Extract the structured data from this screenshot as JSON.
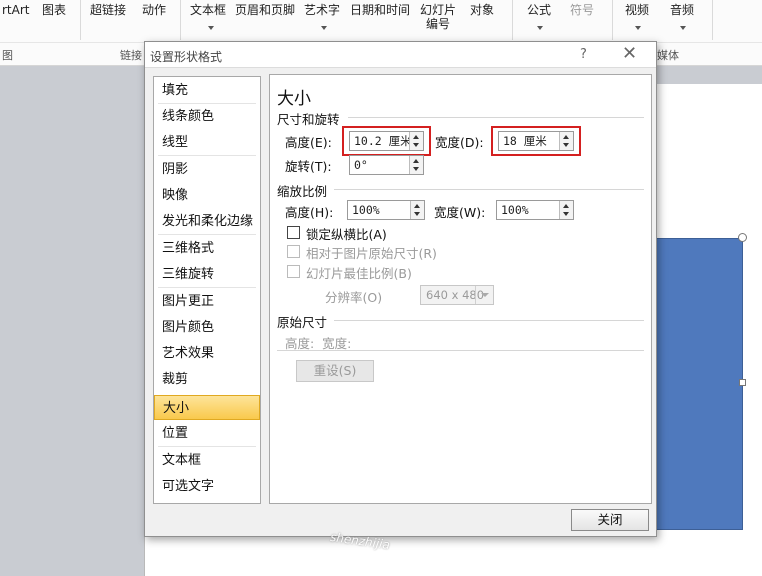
{
  "ribbon": {
    "items": {
      "smartart": "rtArt",
      "chart": "图表",
      "hyperlink": "超链接",
      "action": "动作",
      "textbox": "文本框",
      "header_footer": "页眉和页脚",
      "wordart": "艺术字",
      "datetime": "日期和时间",
      "slide_number": "幻灯片\n编号",
      "object": "对象",
      "formula": "公式",
      "symbol": "符号",
      "video": "视频",
      "audio": "音频"
    },
    "groups": {
      "illustrations": "图",
      "links": "链接",
      "media": "媒体"
    }
  },
  "dialog": {
    "title": "设置形状格式",
    "help": "?",
    "close": "✕",
    "nav_items": [
      "填充",
      "线条颜色",
      "线型",
      "阴影",
      "映像",
      "发光和柔化边缘",
      "三维格式",
      "三维旋转",
      "图片更正",
      "图片颜色",
      "艺术效果",
      "裁剪",
      "大小",
      "位置",
      "文本框",
      "可选文字"
    ],
    "active_item": "大小",
    "heading": "大小",
    "size_rotate": {
      "section": "尺寸和旋转",
      "height_label": "高度(E):",
      "height_value": "10.2 厘米",
      "width_label": "宽度(D):",
      "width_value": "18 厘米",
      "rotation_label": "旋转(T):",
      "rotation_value": "0°"
    },
    "scale": {
      "section": "缩放比例",
      "height_label": "高度(H):",
      "height_value": "100%",
      "width_label": "宽度(W):",
      "width_value": "100%",
      "lock_aspect": "锁定纵横比(A)",
      "relative_original": "相对于图片原始尺寸(R)",
      "best_scale": "幻灯片最佳比例(B)",
      "resolution_label": "分辨率(O)",
      "resolution_value": "640 x 480"
    },
    "original": {
      "section": "原始尺寸",
      "dims": "高度:  宽度:",
      "reset": "重设(S)"
    },
    "close_button": "关闭"
  },
  "watermark": "shenzhijia",
  "colors": {
    "shape_fill": "#4f79bd",
    "highlight": "#d42020",
    "active_nav": "#f9c94c"
  }
}
